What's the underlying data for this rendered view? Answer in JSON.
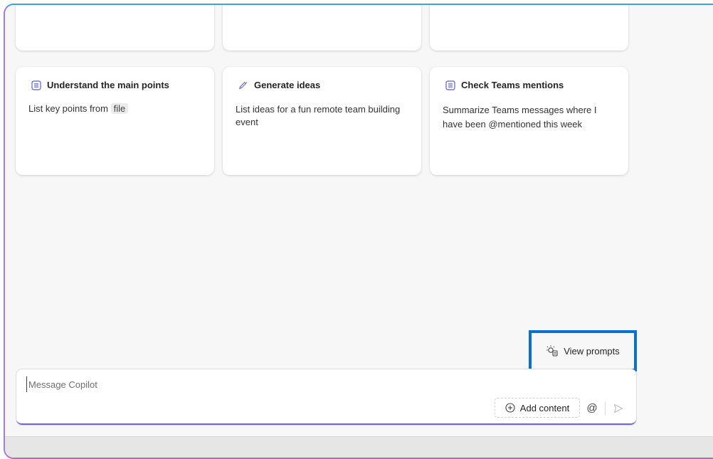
{
  "cards_top": [
    {},
    {},
    {}
  ],
  "cards": [
    {
      "icon": "list-icon",
      "title": "Understand the main points",
      "body_prefix": "List key points from",
      "body_token": "file"
    },
    {
      "icon": "pen-sparkle-icon",
      "title": "Generate ideas",
      "body": "List ideas for a fun remote team building event"
    },
    {
      "icon": "list-icon",
      "title": "Check Teams mentions",
      "body": "Summarize Teams messages where I have been @mentioned this week"
    }
  ],
  "view_prompts": {
    "label": "View prompts",
    "icon": "prompts-icon"
  },
  "composer": {
    "placeholder": "Message Copilot",
    "add_content_label": "Add content",
    "mention_symbol": "@"
  },
  "colors": {
    "accent": "#0a6fd0",
    "icon_purple": "#5b5fc7",
    "composer_underline": "#6a64e6"
  }
}
